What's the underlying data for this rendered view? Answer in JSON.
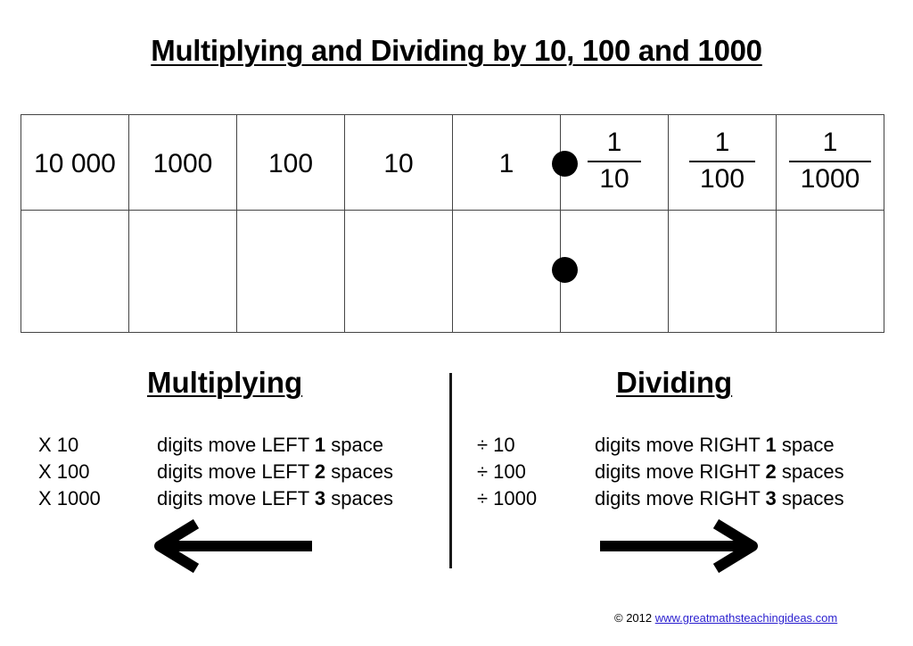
{
  "title": "Multiplying and Dividing by 10, 100 and 1000",
  "place_value_table": {
    "headers": [
      {
        "type": "whole",
        "label": "10 000"
      },
      {
        "type": "whole",
        "label": "1000"
      },
      {
        "type": "whole",
        "label": "100"
      },
      {
        "type": "whole",
        "label": "10"
      },
      {
        "type": "whole",
        "label": "1"
      },
      {
        "type": "fraction",
        "numerator": "1",
        "denominator": "10"
      },
      {
        "type": "fraction",
        "numerator": "1",
        "denominator": "100"
      },
      {
        "type": "fraction",
        "numerator": "1",
        "denominator": "1000"
      }
    ],
    "body_row": [
      "",
      "",
      "",
      "",
      "",
      "",
      "",
      ""
    ],
    "decimal_point_marker": "decimal-point"
  },
  "multiplying": {
    "heading": "Multiplying",
    "rules": [
      {
        "op": "X 10",
        "prefix": "digits move LEFT ",
        "count": "1",
        "suffix": " space"
      },
      {
        "op": "X 100",
        "prefix": "digits move LEFT ",
        "count": "2",
        "suffix": " spaces"
      },
      {
        "op": "X 1000",
        "prefix": "digits move LEFT ",
        "count": "3",
        "suffix": " spaces"
      }
    ],
    "arrow": "arrow-left-icon"
  },
  "dividing": {
    "heading": "Dividing",
    "rules": [
      {
        "op": "÷ 10",
        "prefix": "digits move RIGHT ",
        "count": "1",
        "suffix": " space"
      },
      {
        "op": "÷ 100",
        "prefix": "digits move RIGHT ",
        "count": "2",
        "suffix": " spaces"
      },
      {
        "op": "÷ 1000",
        "prefix": "digits move RIGHT ",
        "count": "3",
        "suffix": " spaces"
      }
    ],
    "arrow": "arrow-right-icon"
  },
  "footer": {
    "copyright": "© 2012 ",
    "link_text": "www.greatmathsteachingideas.com",
    "link_color": "#2a1fcf"
  }
}
